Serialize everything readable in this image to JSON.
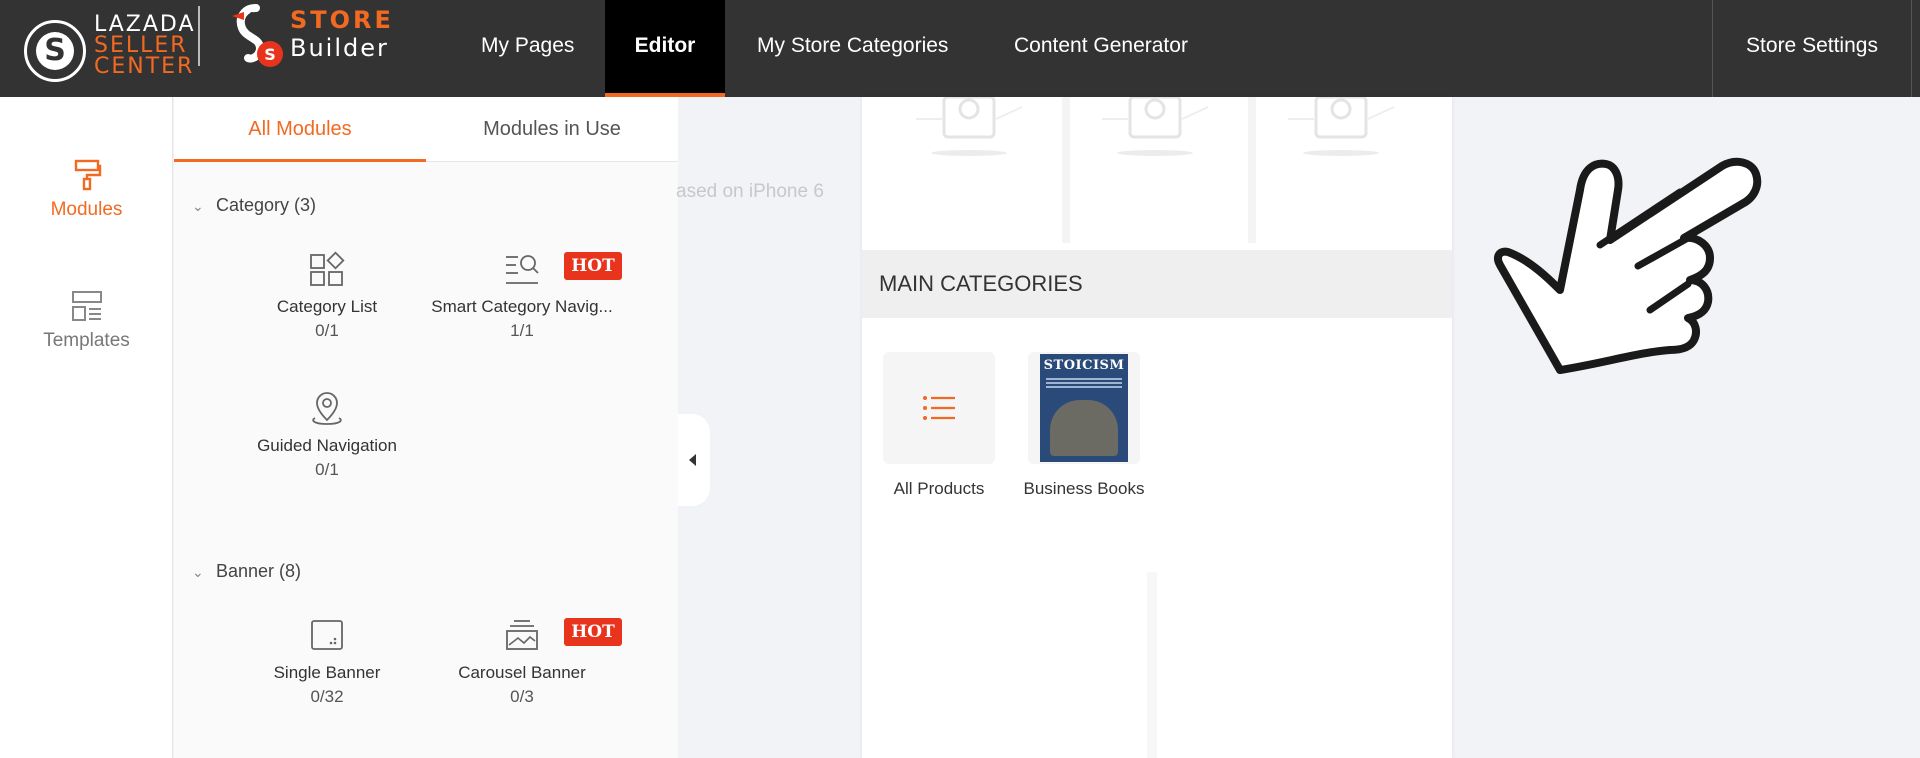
{
  "logo": {
    "lazada_line1": "LAZADA",
    "lazada_line2": "SELLER",
    "lazada_line3": "CENTER",
    "store_line1": "STORE",
    "store_line2": "Builder"
  },
  "nav": {
    "my_pages": "My Pages",
    "editor": "Editor",
    "my_store_categories": "My Store Categories",
    "content_generator": "Content Generator",
    "store_settings": "Store Settings"
  },
  "rail": {
    "modules": "Modules",
    "templates": "Templates"
  },
  "tabs": {
    "all_modules": "All Modules",
    "modules_in_use": "Modules in Use"
  },
  "sections": {
    "category": {
      "title": "Category (3)",
      "items": [
        {
          "name": "Category List",
          "count": "0/1",
          "icon": "category-list-icon"
        },
        {
          "name": "Smart Category Navig...",
          "count": "1/1",
          "icon": "smart-category-icon",
          "badge": "HOT"
        },
        {
          "name": "Guided Navigation",
          "count": "0/1",
          "icon": "location-pin-icon"
        }
      ]
    },
    "banner": {
      "title": "Banner (8)",
      "items": [
        {
          "name": "Single Banner",
          "count": "0/32",
          "icon": "single-banner-icon"
        },
        {
          "name": "Carousel Banner",
          "count": "0/3",
          "icon": "carousel-banner-icon",
          "badge": "HOT"
        }
      ]
    }
  },
  "hint_text": "ased on iPhone 6",
  "preview": {
    "main_categories_title": "MAIN CATEGORIES",
    "categories": [
      {
        "label": "All Products"
      },
      {
        "label": "Business Books"
      }
    ],
    "book_title": "STOICISM"
  },
  "colors": {
    "accent": "#f26a21",
    "topbar": "#333333",
    "hot_badge": "#e8341c"
  }
}
